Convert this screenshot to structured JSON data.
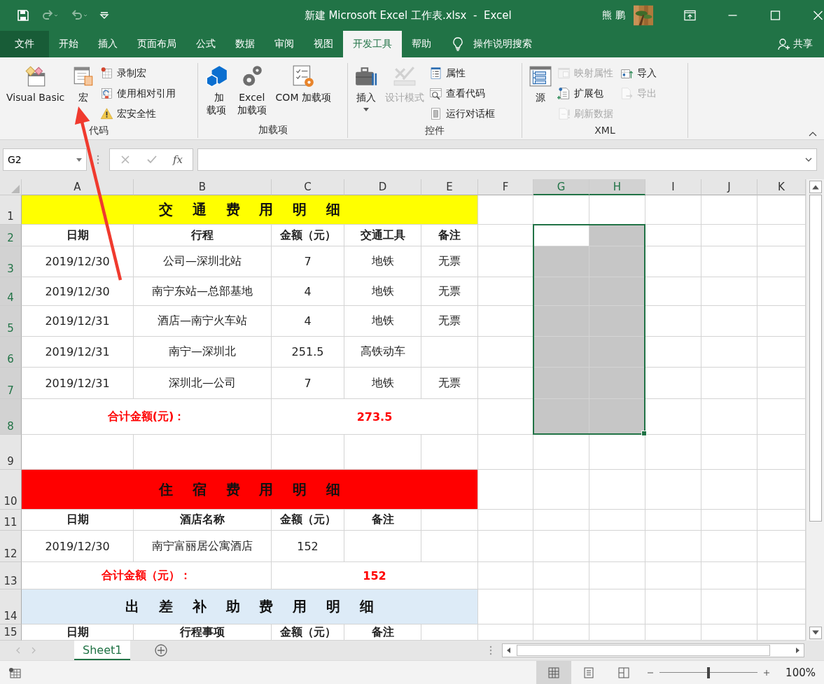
{
  "window": {
    "title": "新建 Microsoft Excel 工作表.xlsx  -  Excel",
    "user": "熊 鹏"
  },
  "tabs": [
    {
      "label": "文件",
      "kind": "file",
      "selected": false
    },
    {
      "label": "开始",
      "kind": "tab",
      "selected": false
    },
    {
      "label": "插入",
      "kind": "tab",
      "selected": false
    },
    {
      "label": "页面布局",
      "kind": "tab",
      "selected": false
    },
    {
      "label": "公式",
      "kind": "tab",
      "selected": false
    },
    {
      "label": "数据",
      "kind": "tab",
      "selected": false
    },
    {
      "label": "审阅",
      "kind": "tab",
      "selected": false
    },
    {
      "label": "视图",
      "kind": "tab",
      "selected": false
    },
    {
      "label": "开发工具",
      "kind": "tab",
      "selected": true
    },
    {
      "label": "帮助",
      "kind": "tab",
      "selected": false
    }
  ],
  "tell_me": "操作说明搜索",
  "share": "共享",
  "ribbon": {
    "groups": [
      {
        "label": "代码",
        "items": [
          {
            "label": "Visual Basic",
            "kind": "big",
            "disabled": false
          },
          {
            "label": "宏",
            "kind": "big",
            "disabled": false
          },
          {
            "label": "录制宏",
            "kind": "small",
            "disabled": false
          },
          {
            "label": "使用相对引用",
            "kind": "small",
            "disabled": false
          },
          {
            "label": "宏安全性",
            "kind": "small",
            "disabled": false
          }
        ]
      },
      {
        "label": "加载项",
        "items": [
          {
            "label": "加载项",
            "kind": "big",
            "disabled": false
          },
          {
            "label": "Excel 加载项",
            "kind": "big",
            "disabled": false
          },
          {
            "label": "COM 加载项",
            "kind": "big",
            "disabled": false
          }
        ]
      },
      {
        "label": "控件",
        "items": [
          {
            "label": "插入",
            "kind": "big",
            "disabled": false,
            "dropdown": true
          },
          {
            "label": "设计模式",
            "kind": "big",
            "disabled": true
          },
          {
            "label": "属性",
            "kind": "small",
            "disabled": false
          },
          {
            "label": "查看代码",
            "kind": "small",
            "disabled": false
          },
          {
            "label": "运行对话框",
            "kind": "small",
            "disabled": false
          }
        ]
      },
      {
        "label": "XML",
        "items": [
          {
            "label": "源",
            "kind": "big",
            "disabled": false
          },
          {
            "label": "映射属性",
            "kind": "small",
            "disabled": true
          },
          {
            "label": "扩展包",
            "kind": "small",
            "disabled": false
          },
          {
            "label": "刷新数据",
            "kind": "small",
            "disabled": true
          },
          {
            "label": "导入",
            "kind": "small",
            "disabled": false
          },
          {
            "label": "导出",
            "kind": "small",
            "disabled": true
          }
        ]
      }
    ]
  },
  "formula_bar": {
    "name_box": "G2",
    "function_label": "fx"
  },
  "sheet": {
    "columns": [
      {
        "label": "A",
        "selected": false
      },
      {
        "label": "B",
        "selected": false
      },
      {
        "label": "C",
        "selected": false
      },
      {
        "label": "D",
        "selected": false
      },
      {
        "label": "E",
        "selected": false
      },
      {
        "label": "F",
        "selected": false
      },
      {
        "label": "G",
        "selected": true
      },
      {
        "label": "H",
        "selected": true
      },
      {
        "label": "I",
        "selected": false
      },
      {
        "label": "J",
        "selected": false
      },
      {
        "label": "K",
        "selected": false
      }
    ],
    "rows": [
      {
        "number": "1",
        "kind": "title",
        "selected": false,
        "color": "#ffff00",
        "cells": [
          "交    通    费    用    明    细"
        ]
      },
      {
        "number": "2",
        "kind": "header",
        "selected": true,
        "cells": [
          "日期",
          "行程",
          "金额（元）",
          "交通工具",
          "备注"
        ]
      },
      {
        "number": "3",
        "kind": "data",
        "selected": true,
        "cells": [
          "2019/12/30",
          "公司—深圳北站",
          "7",
          "地铁",
          "无票"
        ]
      },
      {
        "number": "4",
        "kind": "data",
        "selected": true,
        "cells": [
          "2019/12/30",
          "南宁东站—总部基地",
          "4",
          "地铁",
          "无票"
        ]
      },
      {
        "number": "5",
        "kind": "data",
        "selected": true,
        "cells": [
          "2019/12/31",
          "酒店—南宁火车站",
          "4",
          "地铁",
          "无票"
        ]
      },
      {
        "number": "6",
        "kind": "data",
        "selected": true,
        "cells": [
          "2019/12/31",
          "南宁—深圳北",
          "251.5",
          "高铁动车"
        ]
      },
      {
        "number": "7",
        "kind": "data",
        "selected": true,
        "cells": [
          "2019/12/31",
          "深圳北—公司",
          "7",
          "地铁",
          "无票"
        ]
      },
      {
        "number": "8",
        "kind": "total",
        "selected": true,
        "cells": [
          "合计金额(元)：",
          "273.5"
        ]
      },
      {
        "number": "9",
        "kind": "blank",
        "selected": false
      },
      {
        "number": "10",
        "kind": "title",
        "selected": false,
        "color": "#ff0000",
        "cells": [
          "住    宿    费    用    明    细"
        ]
      },
      {
        "number": "11",
        "kind": "header",
        "selected": false,
        "cells": [
          "日期",
          "酒店名称",
          "金额（元）",
          "备注"
        ]
      },
      {
        "number": "12",
        "kind": "data",
        "selected": false,
        "cells": [
          "2019/12/30",
          "南宁富丽居公寓酒店",
          "152"
        ]
      },
      {
        "number": "13",
        "kind": "total",
        "selected": false,
        "cells": [
          "合计金额（元）：",
          "152"
        ]
      },
      {
        "number": "14",
        "kind": "title",
        "selected": false,
        "color": "#ddebf7",
        "cells": [
          "出    差    补    助    费    用    明    细"
        ]
      },
      {
        "number": "15",
        "kind": "header",
        "selected": false,
        "cells": [
          "日期",
          "行程事项",
          "金额（元）",
          "备注"
        ]
      }
    ]
  },
  "sheet_tabs": [
    {
      "label": "Sheet1",
      "selected": true
    }
  ],
  "status_bar": {
    "views": [
      {
        "kind": "normal",
        "selected": true
      },
      {
        "kind": "page_layout",
        "selected": false
      },
      {
        "kind": "page_break",
        "selected": false
      }
    ],
    "zoom_slider": {
      "level": 0.5
    },
    "zoom": "100%"
  }
}
